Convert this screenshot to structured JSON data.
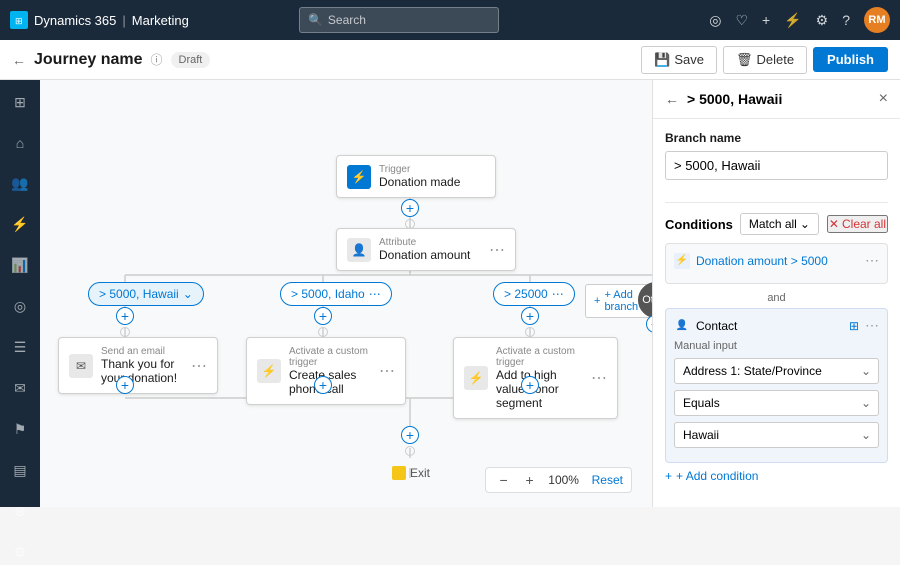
{
  "app": {
    "name": "Dynamics 365",
    "module": "Marketing"
  },
  "nav": {
    "search_placeholder": "Search",
    "avatar_initials": "RM"
  },
  "header": {
    "back_label": "←",
    "title": "Journey name",
    "status": "Draft",
    "save_label": "Save",
    "delete_label": "Delete",
    "publish_label": "Publish"
  },
  "canvas": {
    "zoom_level": "100%",
    "zoom_reset": "Reset",
    "trigger": {
      "label_small": "Trigger",
      "label_main": "Donation made"
    },
    "attribute": {
      "label_small": "Attribute",
      "label_main": "Donation amount"
    },
    "branches": [
      {
        "id": "b1",
        "label": "> 5000, Hawaii",
        "active": true
      },
      {
        "id": "b2",
        "label": "> 5000, Idaho",
        "active": false
      },
      {
        "id": "b3",
        "label": "> 25000",
        "active": false
      },
      {
        "id": "b4",
        "label": "Other",
        "type": "other"
      }
    ],
    "add_branch_label": "+ Add branch",
    "actions": [
      {
        "label_small": "Send an email",
        "label_main": "Thank you for your donation!"
      },
      {
        "label_small": "Activate a custom trigger",
        "label_main": "Create sales phone call"
      },
      {
        "label_small": "Activate a custom trigger",
        "label_main": "Add to high value donor segment"
      }
    ],
    "exit_label": "Exit"
  },
  "panel": {
    "back_label": "←",
    "title": "> 5000, Hawaii",
    "close_label": "×",
    "branch_name_label": "Branch name",
    "branch_name_value": "> 5000, Hawaii",
    "conditions_label": "Conditions",
    "match_all_label": "Match all",
    "clear_all_label": "Clear all",
    "condition1": {
      "icon": "⚡",
      "text": "Donation amount > 5000",
      "and_label": "and"
    },
    "sub_condition": {
      "icon": "👤",
      "label": "Contact",
      "manual_input_label": "Manual input",
      "resize_icon": "⊞"
    },
    "dropdowns": {
      "field": "Address 1: State/Province",
      "operator": "Equals",
      "value": "Hawaii"
    },
    "add_condition_label": "+ Add condition"
  }
}
